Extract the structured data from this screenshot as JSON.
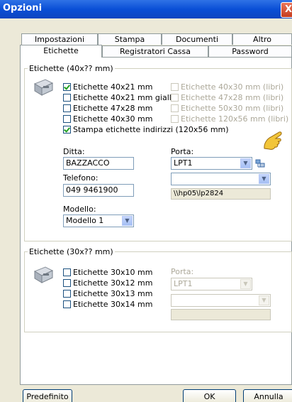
{
  "window": {
    "title": "Opzioni",
    "close_symbol": "X"
  },
  "tabs": {
    "row1": [
      "Impostazioni",
      "Stampa",
      "Documenti",
      "Altro"
    ],
    "row2": [
      "Etichette",
      "Registratori Cassa",
      "Password"
    ],
    "active": "Etichette"
  },
  "group1": {
    "legend": "Etichette (40x?? mm)",
    "left_checks": [
      {
        "label": "Etichette 40x21 mm",
        "checked": true
      },
      {
        "label": "Etichette 40x21 mm gialle",
        "checked": false
      },
      {
        "label": "Etichette 47x28 mm",
        "checked": false
      },
      {
        "label": "Etichette 40x30 mm",
        "checked": false
      },
      {
        "label": "Stampa etichette indirizzi (120x56 mm)",
        "checked": true
      }
    ],
    "right_checks": [
      {
        "label": "Etichette 40x30 mm (libri)"
      },
      {
        "label": "Etichette 47x28 mm (libri)"
      },
      {
        "label": "Etichette 50x30 mm (libri)"
      },
      {
        "label": "Etichette 120x56 mm (libri)"
      }
    ],
    "ditta": {
      "label": "Ditta:",
      "value": "BAZZACCO"
    },
    "telefono": {
      "label": "Telefono:",
      "value": "049 9461900"
    },
    "modello": {
      "label": "Modello:",
      "value": "Modello 1"
    },
    "porta": {
      "label": "Porta:",
      "value": "LPT1",
      "second_value": "",
      "path": "\\\\hp05\\lp2824"
    }
  },
  "group2": {
    "legend": "Etichette (30x?? mm)",
    "checks": [
      {
        "label": "Etichette 30x10 mm"
      },
      {
        "label": "Etichette 30x12 mm"
      },
      {
        "label": "Etichette 30x13 mm"
      },
      {
        "label": "Etichette 30x14 mm"
      }
    ],
    "porta": {
      "label": "Porta:",
      "value": "LPT1"
    }
  },
  "buttons": {
    "default": "Predefinito",
    "ok": "OK",
    "cancel": "Annulla"
  },
  "colors": {
    "titlebar": "#0a4fd6",
    "dialog": "#ece9d8",
    "check": "#21a121"
  }
}
